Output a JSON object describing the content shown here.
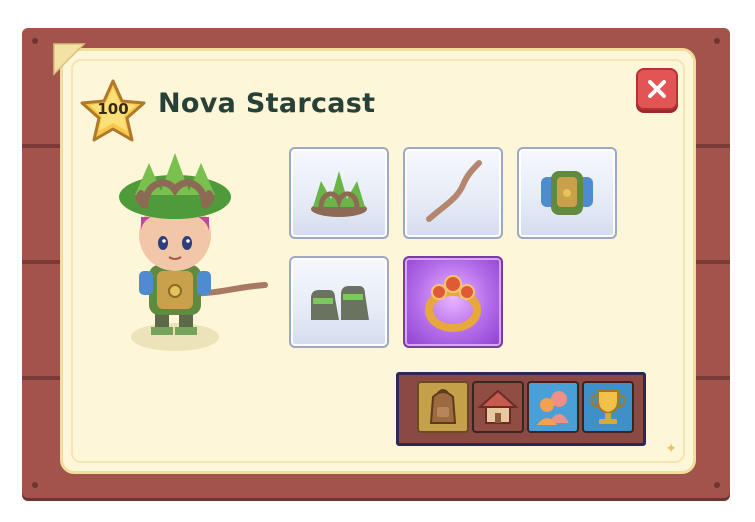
{
  "player": {
    "level": "100",
    "name": "Nova Starcast"
  },
  "icons": {
    "close": "close-icon",
    "level": "star-badge-icon"
  },
  "equipment": [
    {
      "slot": "head",
      "item": "leaf-crown-hat-icon"
    },
    {
      "slot": "weapon",
      "item": "wooden-wand-icon"
    },
    {
      "slot": "outfit",
      "item": "leaf-armor-outfit-icon"
    },
    {
      "slot": "boots",
      "item": "moss-boots-icon"
    },
    {
      "slot": "relic",
      "item": "gold-ring-icon"
    }
  ],
  "tabs": [
    {
      "name": "backpack",
      "icon": "backpack-icon",
      "selected": true
    },
    {
      "name": "house",
      "icon": "house-icon",
      "selected": false
    },
    {
      "name": "friends",
      "icon": "friends-icon",
      "selected": false
    },
    {
      "name": "achievements",
      "icon": "trophy-icon",
      "selected": false
    }
  ],
  "colors": {
    "frame": "#a2544c",
    "panel": "#fdf6d8",
    "name_text": "#274038",
    "close_button": "#e35554",
    "relic_slot": "#b26be8"
  }
}
